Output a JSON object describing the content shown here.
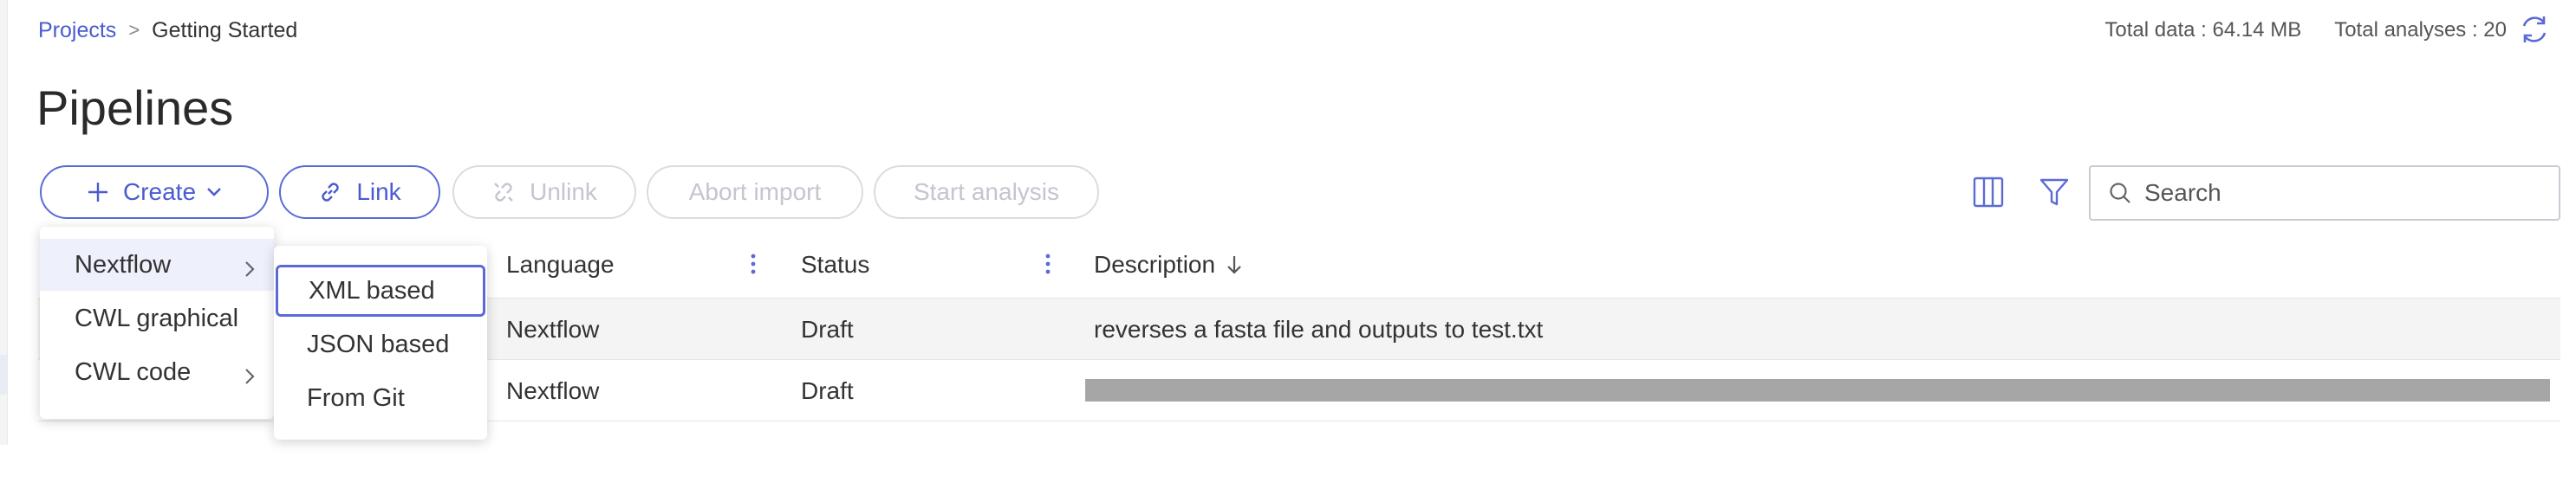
{
  "breadcrumb": {
    "root": "Projects",
    "current": "Getting Started"
  },
  "totals": {
    "data": "Total data : 64.14 MB",
    "analyses": "Total analyses : 20"
  },
  "page": {
    "title": "Pipelines"
  },
  "toolbar": {
    "create_label": "Create",
    "link_label": "Link",
    "unlink_label": "Unlink",
    "abort_label": "Abort import",
    "start_label": "Start analysis"
  },
  "search": {
    "placeholder": "Search"
  },
  "table": {
    "columns": {
      "language": "Language",
      "status": "Status",
      "description": "Description"
    },
    "rows": [
      {
        "language": "Nextflow",
        "status": "Draft",
        "description": "reverses a fasta file and outputs to test.txt"
      },
      {
        "language": "Nextflow",
        "status": "Draft",
        "description": ""
      }
    ]
  },
  "create_menu": {
    "items": [
      {
        "label": "Nextflow",
        "has_submenu": true,
        "selected": true
      },
      {
        "label": "CWL graphical",
        "has_submenu": false
      },
      {
        "label": "CWL code",
        "has_submenu": true
      }
    ]
  },
  "nextflow_submenu": {
    "items": [
      {
        "label": "XML based",
        "focused": true
      },
      {
        "label": "JSON based"
      },
      {
        "label": "From Git"
      }
    ]
  },
  "colors": {
    "accent": "#4a5bd0",
    "disabled": "#c3c6cf",
    "redaction": "#a6a6a6"
  },
  "icons": [
    "refresh-icon",
    "plus-icon",
    "chevron-down-icon",
    "link-icon",
    "unlink-icon",
    "columns-icon",
    "filter-icon",
    "search-icon",
    "sort-arrow-icon",
    "kebab-icon",
    "chevron-right-icon"
  ]
}
